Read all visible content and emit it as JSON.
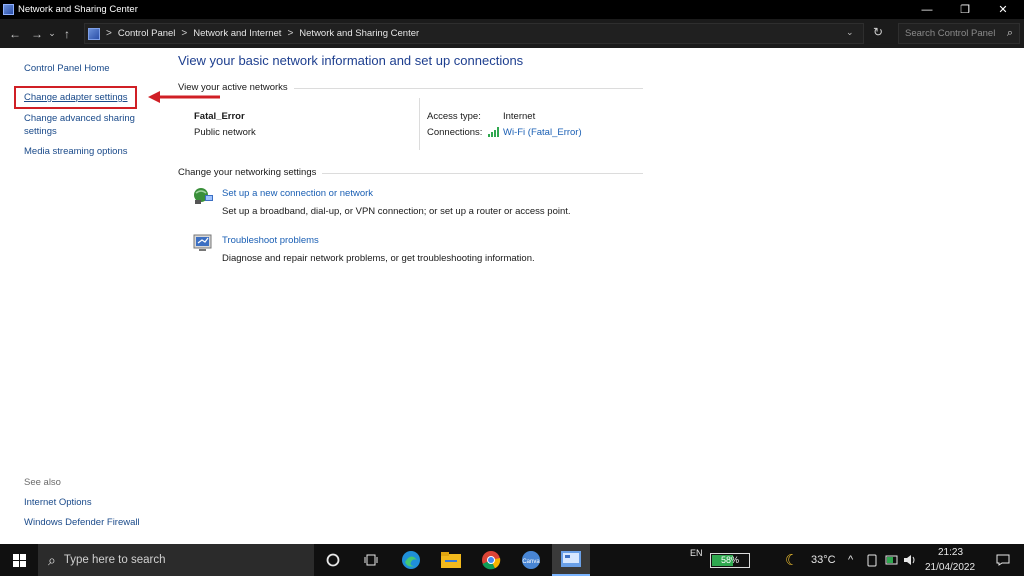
{
  "window": {
    "title": "Network and Sharing Center",
    "minimize_glyph": "—",
    "maximize_glyph": "❐",
    "close_glyph": "✕"
  },
  "address_bar": {
    "back_glyph": "←",
    "forward_glyph": "→",
    "recent_glyph": "⌄",
    "up_glyph": "↑",
    "breadcrumbs": [
      "Control Panel",
      "Network and Internet",
      "Network and Sharing Center"
    ],
    "separator": ">",
    "dropdown_glyph": "⌄",
    "refresh_glyph": "↻",
    "search_placeholder": "Search Control Panel",
    "search_glyph": "⌕"
  },
  "left_pane": {
    "links": [
      "Control Panel Home",
      "Change adapter settings",
      "Change advanced sharing",
      "settings",
      "Media streaming options"
    ],
    "see_also_title": "See also",
    "see_also_links": [
      "Internet Options",
      "Windows Defender Firewall"
    ],
    "highlight_color": "#d01f25"
  },
  "main": {
    "heading": "View your basic network information and set up connections",
    "active_networks_title": "View your active networks",
    "network": {
      "name": "Fatal_Error",
      "type": "Public network",
      "access_type_label": "Access type:",
      "access_type_value": "Internet",
      "connections_label": "Connections:",
      "connection_name": "Wi-Fi (Fatal_Error)"
    },
    "networking_settings_title": "Change your networking settings",
    "tasks": [
      {
        "icon": "new-connection-icon",
        "link": "Set up a new connection or network",
        "description": "Set up a broadband, dial-up, or VPN connection; or set up a router or access point."
      },
      {
        "icon": "troubleshoot-icon",
        "link": "Troubleshoot problems",
        "description": "Diagnose and repair network problems, or get troubleshooting information."
      }
    ]
  },
  "taskbar": {
    "search_placeholder": "Type here to search",
    "search_glyph": "⌕",
    "apps": [
      "cortana-icon",
      "task-view-icon",
      "edge-icon",
      "file-explorer-icon",
      "chrome-icon",
      "canva-icon",
      "control-panel-icon"
    ],
    "language": "EN",
    "battery_text": "58%",
    "battery_level": 0.58,
    "weather_glyph": "☾",
    "temperature": "33°C",
    "tray_chevron": "^",
    "time": "21:23",
    "date": "21/04/2022",
    "notification_glyph": "▭"
  },
  "colors": {
    "link": "#1a5fb4",
    "heading": "#1e3f8f",
    "titlebar": "#000000",
    "taskbar": "#101010"
  }
}
